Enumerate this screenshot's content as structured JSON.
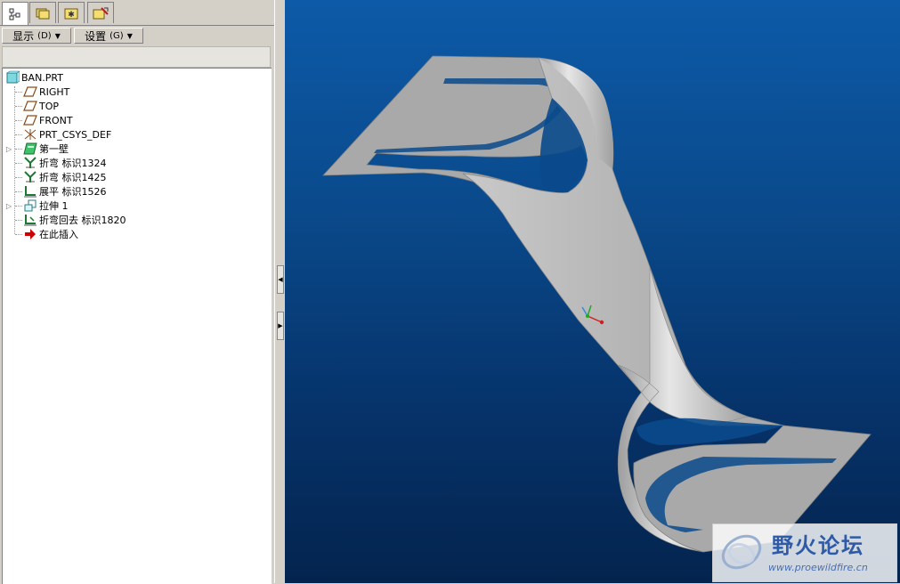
{
  "toolbar": {
    "display_label": "显示",
    "display_key": "(D)",
    "settings_label": "设置",
    "settings_key": "(G)"
  },
  "tree": {
    "root": "BAN.PRT",
    "items": [
      {
        "label": "RIGHT",
        "icon": "datum-plane-icon"
      },
      {
        "label": "TOP",
        "icon": "datum-plane-icon"
      },
      {
        "label": "FRONT",
        "icon": "datum-plane-icon"
      },
      {
        "label": "PRT_CSYS_DEF",
        "icon": "coordinate-system-icon"
      },
      {
        "label": "第一壁",
        "icon": "first-wall-icon"
      },
      {
        "label": "折弯 标识1324",
        "icon": "bend-icon"
      },
      {
        "label": "折弯 标识1425",
        "icon": "bend-icon"
      },
      {
        "label": "展平 标识1526",
        "icon": "unbend-icon"
      },
      {
        "label": "拉伸 1",
        "icon": "extrude-icon"
      },
      {
        "label": "折弯回去 标识1820",
        "icon": "bend-back-icon"
      },
      {
        "label": "在此插入",
        "icon": "insert-here-arrow-icon"
      }
    ]
  },
  "watermark": {
    "title": "野火论坛",
    "url": "www.proewildfire.cn"
  },
  "colors": {
    "viewport_top": "#0d5aa8",
    "viewport_bottom": "#04244e",
    "part_surface": "#b4b4b4",
    "insert_arrow": "#cc0000"
  }
}
